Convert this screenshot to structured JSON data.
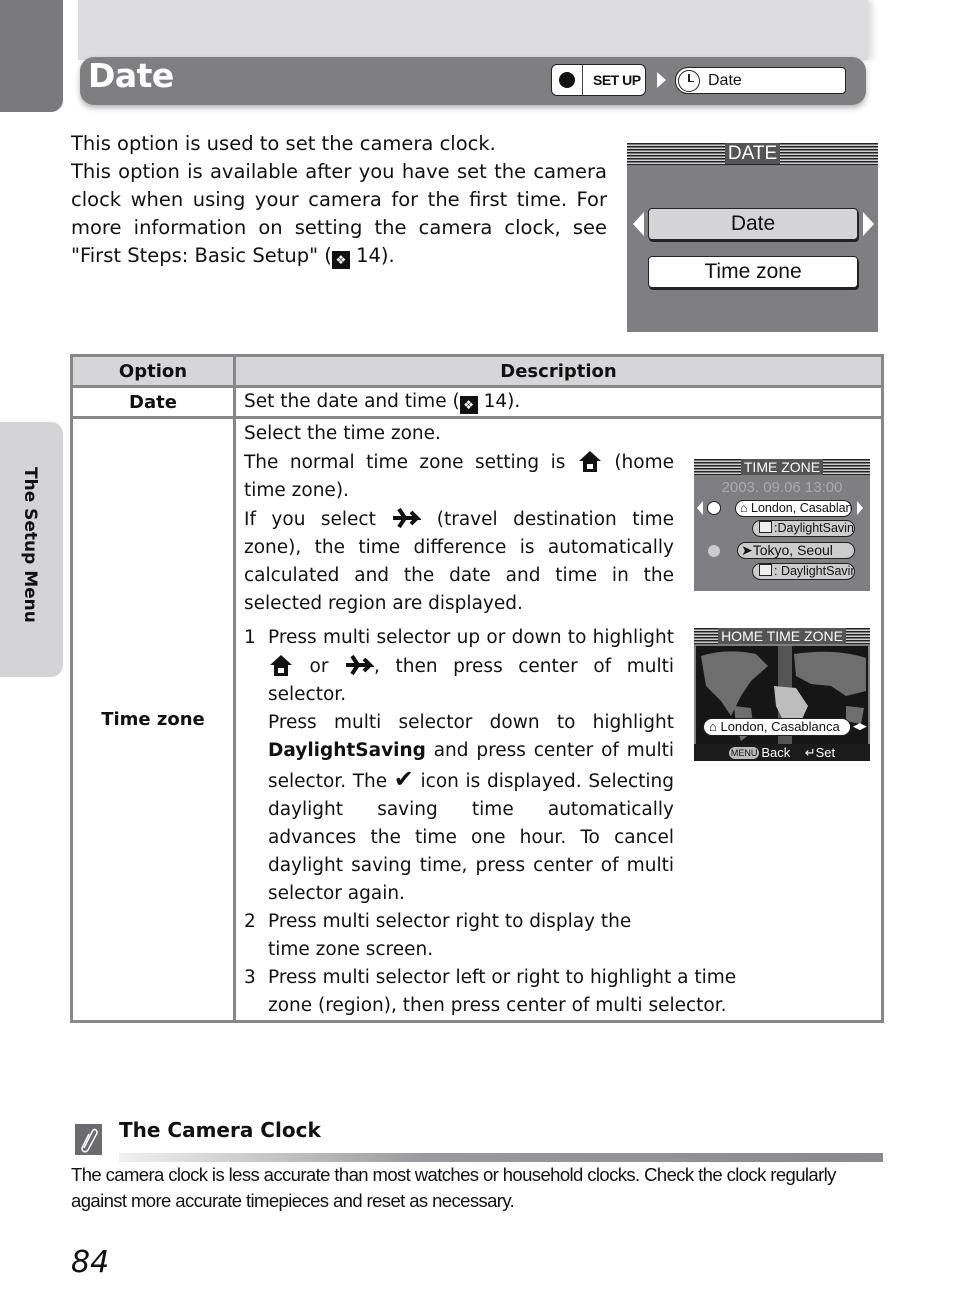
{
  "header": {
    "title": "Date",
    "breadcrumb": {
      "menu": "SET UP",
      "item": "Date"
    }
  },
  "intro": {
    "line1": "This option is used to set the camera clock.",
    "line2a": "This option is available after you have set the camera clock when using your camera for the first time. For more information on setting the camera clock, see \"First Steps: Basic Setup\" (",
    "ref_icon": "book-reference-icon",
    "line2b": " 14)."
  },
  "screen_date": {
    "title": "DATE",
    "items": [
      {
        "label": "Date",
        "selected": true
      },
      {
        "label": "Time zone",
        "selected": false
      }
    ]
  },
  "table": {
    "headers": [
      "Option",
      "Description"
    ],
    "rows": [
      {
        "option": "Date",
        "desc_a": "Set the date and time (",
        "desc_b": " 14)."
      },
      {
        "option": "Time zone",
        "p1": "Select the time zone.",
        "p2a": "The normal time zone setting is ",
        "p2b": " (home time zone).",
        "p3a": "If you select ",
        "p3b": " (travel destination time zone), the time difference is automatically calculated and the date and time in the selected region are displayed.",
        "steps": [
          {
            "n": "1",
            "a": "Press multi selector up or down to highlight ",
            "or": " or ",
            "b": ", then press center of multi selector.",
            "c": "Press multi selector down to highlight ",
            "bold": "DaylightSaving",
            "d": " and press center of multi selector. The ",
            "e": " icon is displayed. Selecting daylight saving time automatically advances the time one hour. To cancel daylight saving time, press center of multi selector again."
          },
          {
            "n": "2",
            "text": "Press multi selector right to display the time zone screen."
          },
          {
            "n": "3",
            "text": "Press multi selector left or right to highlight a time zone (region), then press center of multi selector."
          }
        ]
      }
    ]
  },
  "screen_timezone": {
    "title": "TIME ZONE",
    "datetime": "2003. 09.06  13:00",
    "home": "London, Casablanca",
    "home_dst": ":DaylightSaving",
    "travel": "Tokyo, Seoul",
    "travel_dst": ": DaylightSaving"
  },
  "screen_home": {
    "title": "HOME TIME ZONE",
    "region": "London, Casablanca",
    "menu_badge": "MENU",
    "back": "Back",
    "set": "Set"
  },
  "side_tab": "The Setup Menu",
  "note": {
    "title": "The Camera Clock",
    "body": "The camera clock is less accurate than most watches or household clocks. Check the clock regularly against more accurate timepieces and reset as necessary."
  },
  "page_number": "84"
}
